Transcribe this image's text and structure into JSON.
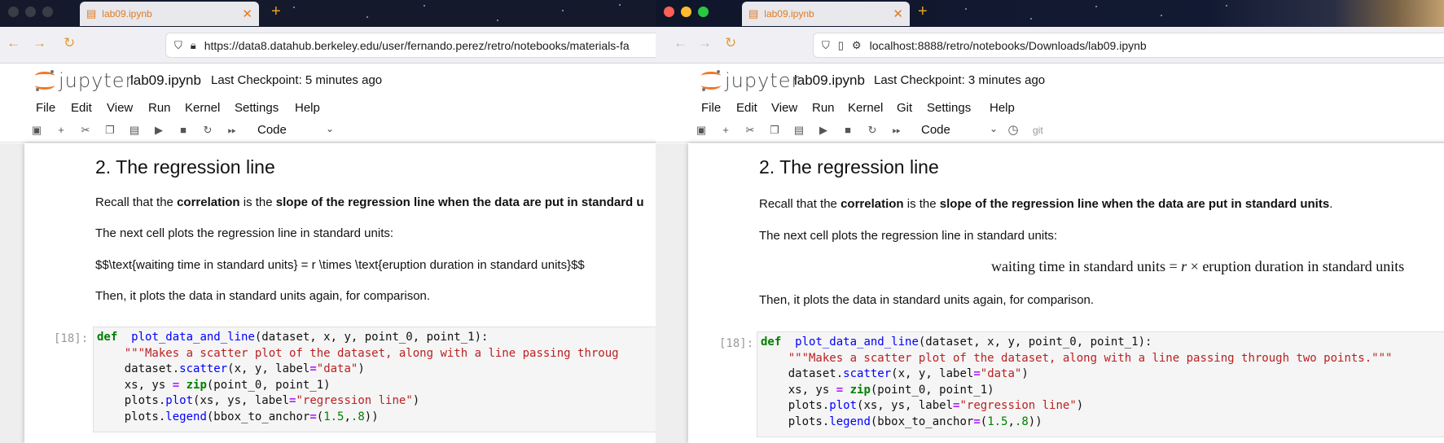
{
  "colors": {
    "accent": "#f37726",
    "tab_text": "#e27b1f"
  },
  "left": {
    "tab_title": "lab09.ipynb",
    "url": "https://data8.datahub.berkeley.edu/user/fernando.perez/retro/notebooks/materials-fa",
    "logo_text": "jupyter",
    "notebook_name": "lab09.ipynb",
    "checkpoint": "Last Checkpoint: 5 minutes ago",
    "menu": [
      "File",
      "Edit",
      "View",
      "Run",
      "Kernel",
      "Settings",
      "Help"
    ],
    "cell_type": "Code",
    "heading": "2. The regression line",
    "para1": {
      "pre": "Recall that the ",
      "b1": "correlation",
      "mid": " is the ",
      "b2": "slope of the regression line when the data are put in standard u",
      "post": ""
    },
    "para2": "The next cell plots the regression line in standard units:",
    "latex": "$$\\text{waiting time in standard units} = r \\times \\text{eruption duration in standard units}$$",
    "para3": "Then, it plots the data in standard units again, for comparison.",
    "prompt": "[18]:",
    "code": [
      [
        [
          "kw",
          "def"
        ],
        [
          "",
          "  "
        ],
        [
          "fn",
          "plot_data_and_line"
        ],
        [
          "",
          "(dataset, x, y, point_0, point_1):"
        ]
      ],
      [
        [
          "",
          "    "
        ],
        [
          "str",
          "\"\"\"Makes a scatter plot of the dataset, along with a line passing throug"
        ]
      ],
      [
        [
          "",
          "    dataset."
        ],
        [
          "fn",
          "scatter"
        ],
        [
          "",
          "(x, y, label"
        ],
        [
          "op",
          "="
        ],
        [
          "str",
          "\"data\""
        ],
        [
          "",
          ")"
        ]
      ],
      [
        [
          "",
          "    xs, ys "
        ],
        [
          "op",
          "="
        ],
        [
          "",
          ""
        ],
        [
          "kw",
          " zip"
        ],
        [
          "",
          "(point_0, point_1)"
        ]
      ],
      [
        [
          "",
          "    plots."
        ],
        [
          "fn",
          "plot"
        ],
        [
          "",
          "(xs, ys, label"
        ],
        [
          "op",
          "="
        ],
        [
          "str",
          "\"regression line\""
        ],
        [
          "",
          ")"
        ]
      ],
      [
        [
          "",
          "    plots."
        ],
        [
          "fn",
          "legend"
        ],
        [
          "",
          "(bbox_to_anchor"
        ],
        [
          "op",
          "="
        ],
        [
          "",
          "("
        ],
        [
          "num",
          "1.5"
        ],
        [
          "",
          ","
        ],
        [
          "num",
          ".8"
        ],
        [
          "",
          "))"
        ]
      ]
    ]
  },
  "right": {
    "tab_title": "lab09.ipynb",
    "url": "localhost:8888/retro/notebooks/Downloads/lab09.ipynb",
    "logo_text": "jupyter",
    "notebook_name": "lab09.ipynb",
    "checkpoint": "Last Checkpoint: 3 minutes ago",
    "menu": [
      "File",
      "Edit",
      "View",
      "Run",
      "Kernel",
      "Git",
      "Settings",
      "Help"
    ],
    "cell_type": "Code",
    "git_label": "git",
    "heading": "2. The regression line",
    "para1": {
      "pre": "Recall that the ",
      "b1": "correlation",
      "mid": " is the ",
      "b2": "slope of the regression line when the data are put in standard units",
      "post": "."
    },
    "para2": "The next cell plots the regression line in standard units:",
    "math": {
      "lhs": "waiting time in standard units",
      "eq": " = ",
      "r": "r",
      "times": " × ",
      "rhs": "eruption duration in standard units"
    },
    "para3": "Then, it plots the data in standard units again, for comparison.",
    "prompt": "[18]:",
    "code": [
      [
        [
          "kw",
          "def"
        ],
        [
          "",
          "  "
        ],
        [
          "fn",
          "plot_data_and_line"
        ],
        [
          "",
          "(dataset, x, y, point_0, point_1):"
        ]
      ],
      [
        [
          "",
          "    "
        ],
        [
          "str",
          "\"\"\"Makes a scatter plot of the dataset, along with a line passing through two points.\"\"\""
        ]
      ],
      [
        [
          "",
          "    dataset."
        ],
        [
          "fn",
          "scatter"
        ],
        [
          "",
          "(x, y, label"
        ],
        [
          "op",
          "="
        ],
        [
          "str",
          "\"data\""
        ],
        [
          "",
          ")"
        ]
      ],
      [
        [
          "",
          "    xs, ys "
        ],
        [
          "op",
          "="
        ],
        [
          "",
          ""
        ],
        [
          "kw",
          " zip"
        ],
        [
          "",
          "(point_0, point_1)"
        ]
      ],
      [
        [
          "",
          "    plots."
        ],
        [
          "fn",
          "plot"
        ],
        [
          "",
          "(xs, ys, label"
        ],
        [
          "op",
          "="
        ],
        [
          "str",
          "\"regression line\""
        ],
        [
          "",
          ")"
        ]
      ],
      [
        [
          "",
          "    plots."
        ],
        [
          "fn",
          "legend"
        ],
        [
          "",
          "(bbox_to_anchor"
        ],
        [
          "op",
          "="
        ],
        [
          "",
          "("
        ],
        [
          "num",
          "1.5"
        ],
        [
          "",
          ","
        ],
        [
          "num",
          ".8"
        ],
        [
          "",
          "))"
        ]
      ]
    ]
  }
}
